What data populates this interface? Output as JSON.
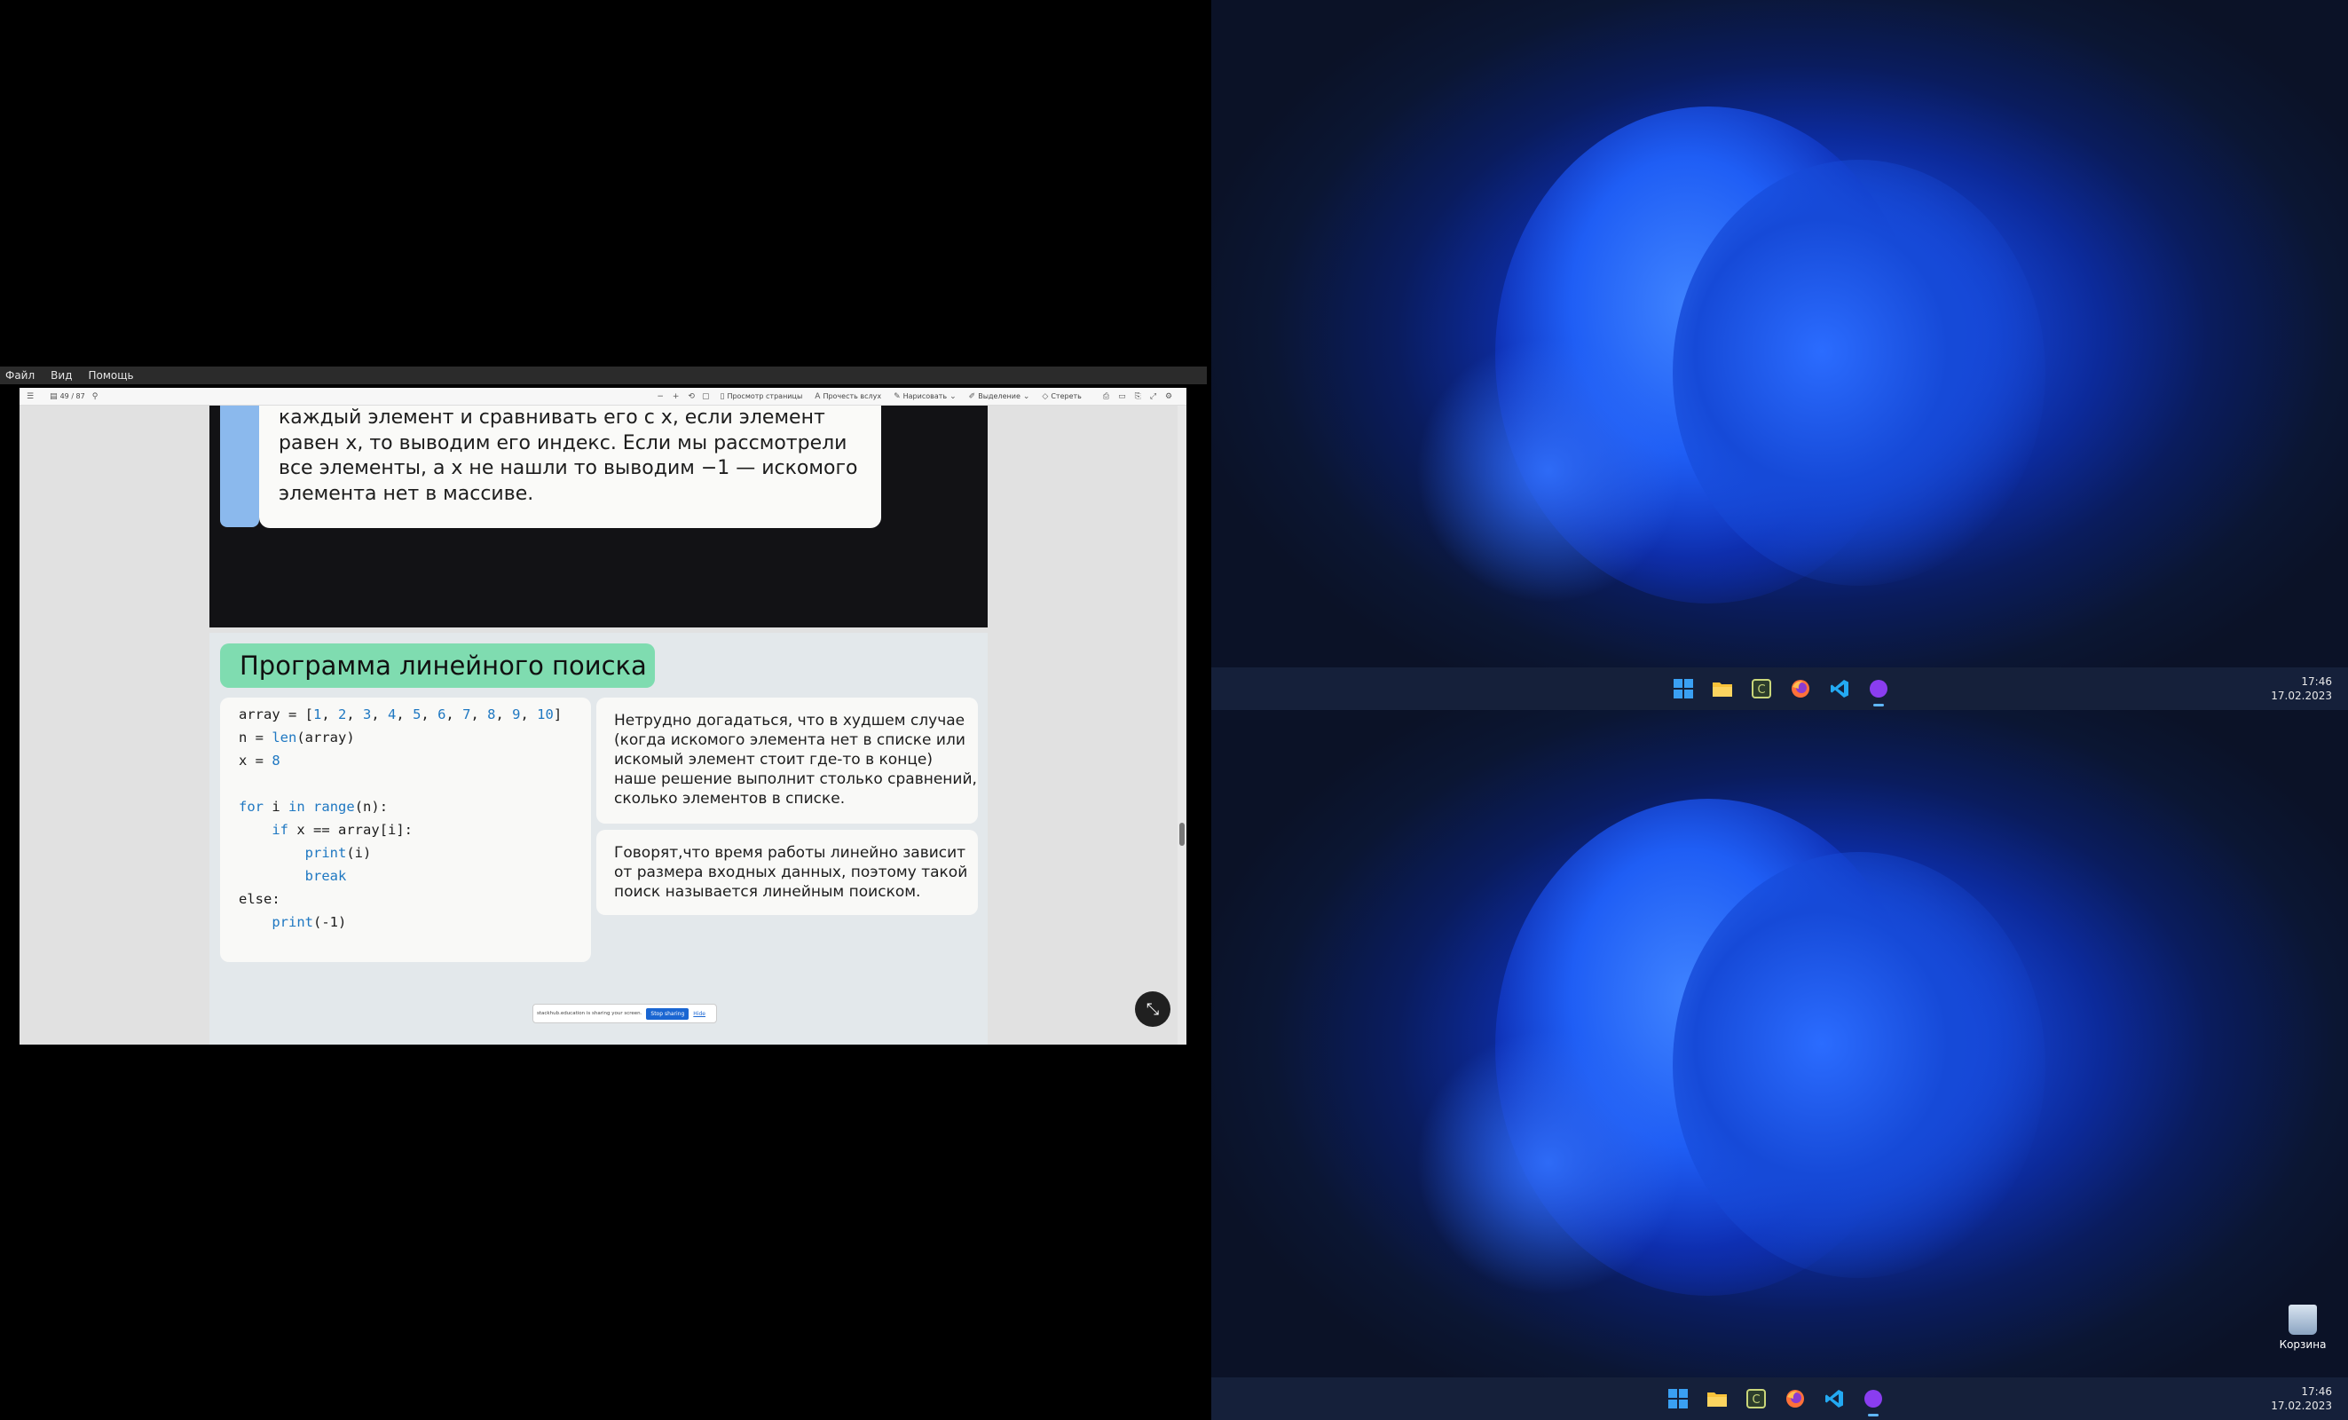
{
  "menubar": {
    "items": [
      "Файл",
      "Вид",
      "Помощь"
    ]
  },
  "viewer_toolbar": {
    "page_box": "49 / 87",
    "items": [
      "Просмотр страницы",
      "Прочесть вслух",
      "Нарисовать",
      "Выделение",
      "Стереть"
    ]
  },
  "slide_prev": {
    "text": "каждый элемент и сравнивать его с x, если элемент равен x, то выводим его индекс. Если мы рассмотрели все элементы, а x не нашли то выводим −1 — искомого элемента нет в массиве."
  },
  "slide": {
    "title": "Программа линейного поиска",
    "code": {
      "array_name": "array",
      "array_values": [
        "1",
        "2",
        "3",
        "4",
        "5",
        "6",
        "7",
        "8",
        "9",
        "10"
      ],
      "n_assign": "n = ",
      "len_func": "len",
      "len_arg": "(array)",
      "x_assign": "x = ",
      "x_value": "8",
      "for_kw": "for",
      "loop_var": "i",
      "in_kw": "in",
      "range_func": "range",
      "range_arg": "(n):",
      "if_kw": "if",
      "condition": "x == ",
      "array_index": "[i]:",
      "print_func": "print",
      "print_arg_i": "(i)",
      "break_kw": "break",
      "else_kw": "else:",
      "print_arg_neg": "(-1)"
    },
    "note_1": "Нетрудно догадаться, что в худшем случае (когда искомого элемента нет в списке или искомый элемент стоит где-то в конце) наше решение выполнит столько сравнений, сколько элементов в списке.",
    "note_2": "Говорят,что время работы линейно зависит от размера входных данных, поэтому такой поиск называется линейным поиском."
  },
  "share_bar": {
    "text": "stackhub.education is sharing your screen.",
    "stop_label": "Stop sharing",
    "hide_label": "Hide"
  },
  "desktop_top": {
    "clock_time": "17:46",
    "clock_date": "17.02.2023",
    "taskbar_icons": [
      "windows-start",
      "file-explorer",
      "app-c",
      "firefox",
      "vscode",
      "obs"
    ]
  },
  "desktop_bottom": {
    "clock_time": "17:46",
    "clock_date": "17.02.2023",
    "recycle_bin_label": "Корзина",
    "taskbar_icons": [
      "windows-start",
      "file-explorer",
      "app-c",
      "firefox",
      "vscode",
      "obs"
    ]
  },
  "colors": {
    "accent_green": "#7fdcb0",
    "accent_blue": "#8bb9ed",
    "code_keyword": "#1f78c2",
    "stop_button": "#1a66d2"
  }
}
